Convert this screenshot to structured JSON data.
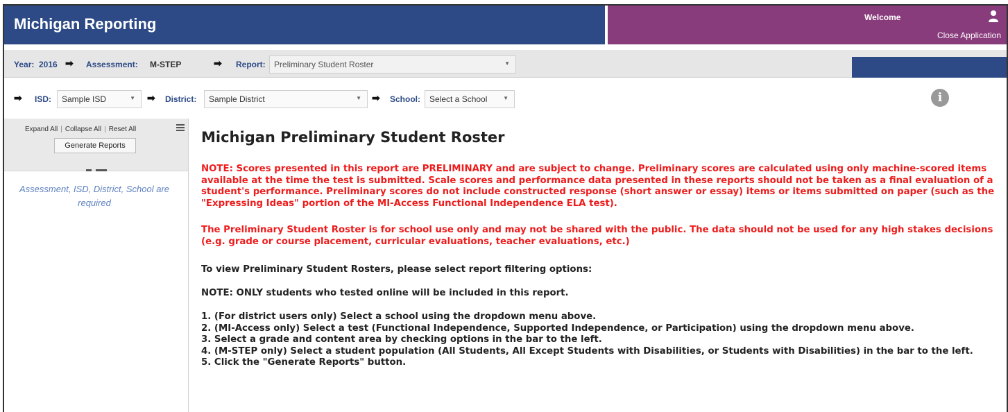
{
  "header": {
    "app_title": "Michigan Reporting",
    "welcome": "Welcome",
    "close_application": "Close Application",
    "colors": {
      "left": "#2d4a86",
      "right": "#893c7c"
    }
  },
  "breadcrumb": {
    "year_label": "Year:",
    "year_value": "2016",
    "assessment_label": "Assessment:",
    "assessment_value": "M-STEP",
    "report_label": "Report:",
    "report_value": "Preliminary Student Roster"
  },
  "filters": {
    "isd_label": "ISD:",
    "isd_value": "Sample ISD",
    "district_label": "District:",
    "district_value": "Sample District",
    "school_label": "School:",
    "school_value": "Select a School"
  },
  "sidebar": {
    "expand_all": "Expand All",
    "collapse_all": "Collapse All",
    "reset_all": "Reset All",
    "generate_reports": "Generate Reports",
    "required_message": "Assessment, ISD, District, School are required"
  },
  "main": {
    "title": "Michigan Preliminary Student Roster",
    "note1": "NOTE: Scores presented in this report are PRELIMINARY and are subject to change. Preliminary scores are calculated using only machine-scored items available at the time the test is submitted. Scale scores and performance data presented in these reports should not be taken as a final evaluation of a student's performance. Preliminary scores do not include constructed response (short answer or essay) items or items submitted on paper (such as the \"Expressing Ideas\" portion of the MI-Access Functional Independence ELA test).",
    "note2": "The Preliminary Student Roster is for school use only and may not be shared with the public. The data should not be used for any high stakes decisions (e.g. grade or course placement, curricular evaluations, teacher evaluations, etc.)",
    "instructions": "To view Preliminary Student Rosters, please select report filtering options:",
    "online_note": "NOTE: ONLY students who tested online will be included in this report.",
    "steps": [
      "1. (For district users only) Select a school using the dropdown menu above.",
      "2. (MI-Access only) Select a test (Functional Independence, Supported Independence, or Participation) using the dropdown menu above.",
      "3. Select a grade and content area by checking options in the bar to the left.",
      "4. (M-STEP only) Select a student population (All Students, All Except Students with Disabilities, or Students with Disabilities) in the bar to the left.",
      "5. Click the \"Generate Reports\" button."
    ]
  }
}
